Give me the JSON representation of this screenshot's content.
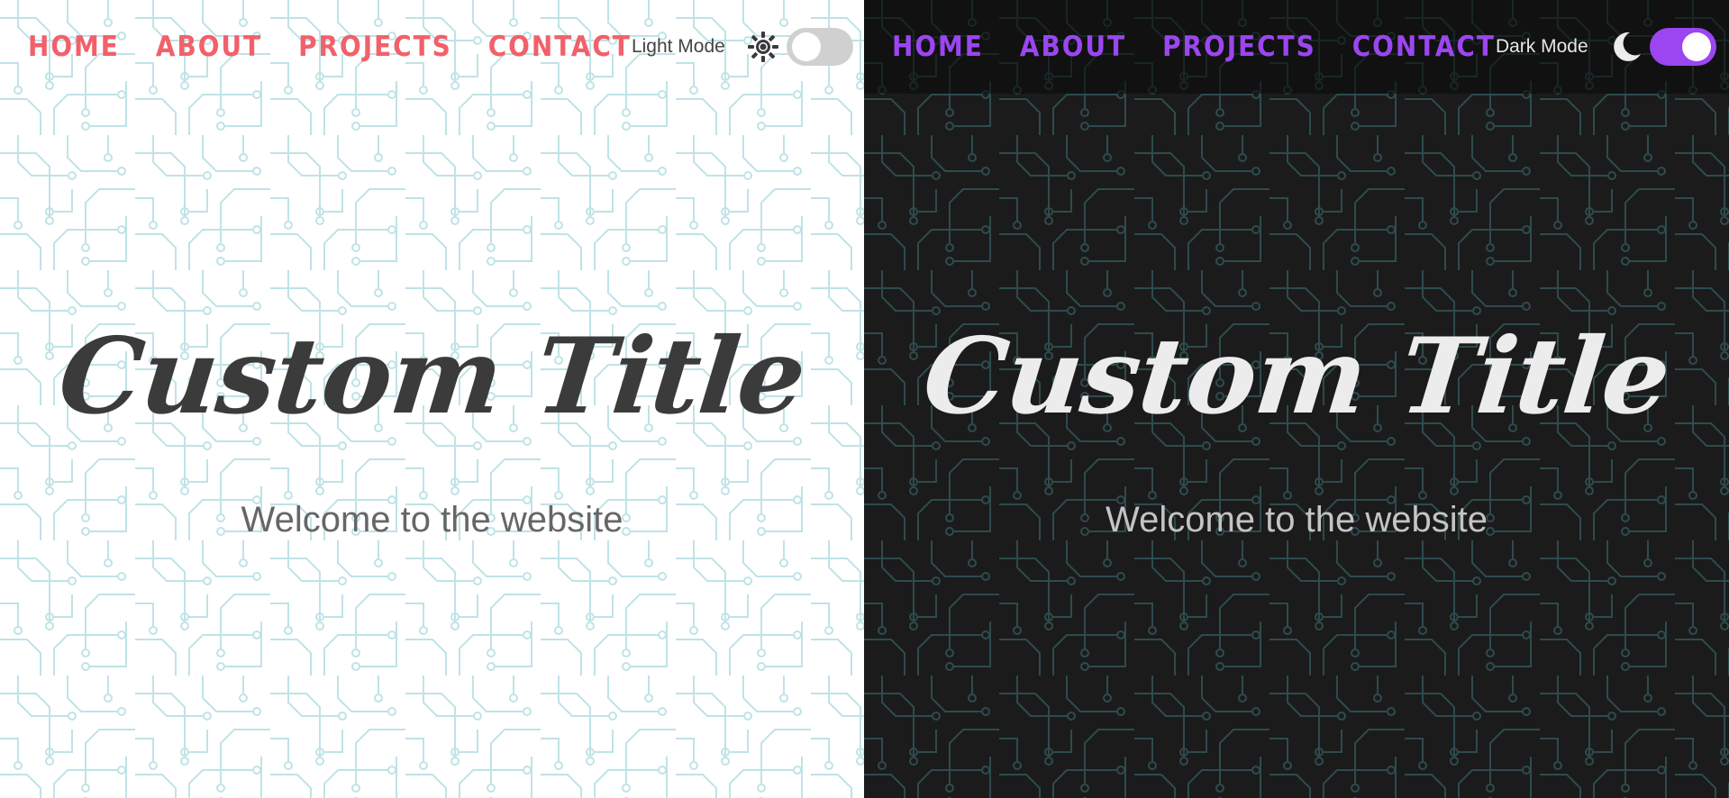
{
  "light_panel": {
    "nav": {
      "home": "HOME",
      "about": "ABOUT",
      "projects": "PROJECTS",
      "contact": "CONTACT"
    },
    "mode_label": "Light Mode",
    "mode_icon": "sun-icon",
    "toggle_on": false,
    "title": "Custom Title",
    "subtitle": "Welcome to the website",
    "colors": {
      "accent": "#f2606a",
      "background": "#ffffff",
      "pattern": "#bfe3e6",
      "title": "#3b3b3b",
      "toggle": "#d0d0d0"
    }
  },
  "dark_panel": {
    "nav": {
      "home": "HOME",
      "about": "ABOUT",
      "projects": "PROJECTS",
      "contact": "CONTACT"
    },
    "mode_label": "Dark Mode",
    "mode_icon": "moon-icon",
    "toggle_on": true,
    "title": "Custom Title",
    "subtitle": "Welcome to the website",
    "colors": {
      "accent": "#9b46f1",
      "background": "#1b1b1b",
      "pattern": "#2e4b4d",
      "title": "#ececec",
      "toggle": "#9b46f1"
    }
  }
}
